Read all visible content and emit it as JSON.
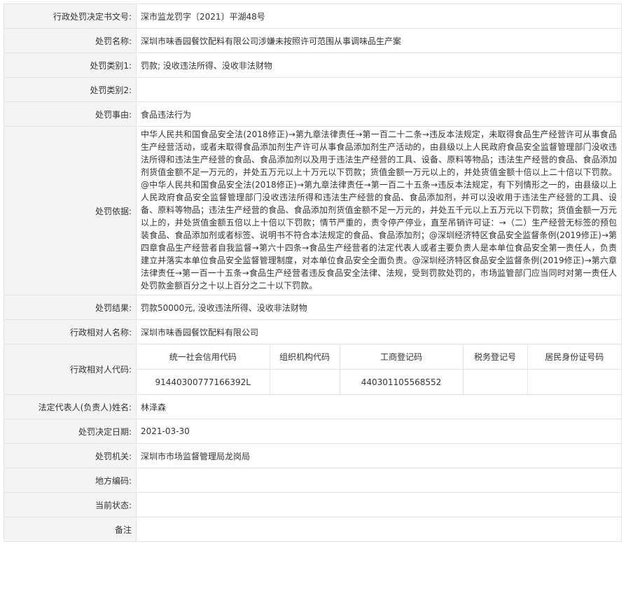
{
  "rows": {
    "doc_no": {
      "label": "行政处罚决定书文号:",
      "value": "深市监龙罚字〔2021〕平湖48号"
    },
    "name": {
      "label": "处罚名称:",
      "value": "深圳市味香园餐饮配料有限公司涉嫌未按照许可范围从事调味品生产案"
    },
    "cat1": {
      "label": "处罚类别1:",
      "value": "罚款; 没收违法所得、没收非法财物"
    },
    "cat2": {
      "label": "处罚类别2:",
      "value": ""
    },
    "reason": {
      "label": "处罚事由:",
      "value": "食品违法行为"
    },
    "basis": {
      "label": "处罚依据:",
      "value": "中华人民共和国食品安全法(2018修正)→第九章法律责任→第一百二十二条→违反本法规定，未取得食品生产经营许可从事食品生产经营活动，或者未取得食品添加剂生产许可从事食品添加剂生产活动的，由县级以上人民政府食品安全监督管理部门没收违法所得和违法生产经营的食品、食品添加剂以及用于违法生产经营的工具、设备、原料等物品；违法生产经营的食品、食品添加剂货值金额不足一万元的，并处五万元以上十万元以下罚款；货值金额一万元以上的，并处货值金额十倍以上二十倍以下罚款。@中华人民共和国食品安全法(2018修正)→第九章法律责任→第一百二十五条→违反本法规定，有下列情形之一的，由县级以上人民政府食品安全监督管理部门没收违法所得和违法生产经营的食品、食品添加剂，并可以没收用于违法生产经营的工具、设备、原料等物品；违法生产经营的食品、食品添加剂货值金额不足一万元的，并处五千元以上五万元以下罚款；货值金额一万元以上的，并处货值金额五倍以上十倍以下罚款；情节严重的，责令停产停业，直至吊销许可证：→（二）生产经营无标签的预包装食品、食品添加剂或者标签、说明书不符合本法规定的食品、食品添加剂；@深圳经济特区食品安全监督条例(2019修正)→第四章食品生产经营者自我监督→第六十四条→食品生产经营者的法定代表人或者主要负责人是本单位食品安全第一责任人，负责建立并落实本单位食品安全监督管理制度，对本单位食品安全全面负责。@深圳经济特区食品安全监督条例(2019修正)→第六章法律责任→第一百一十五条→食品生产经营者违反食品安全法律、法规，受到罚款处罚的，市场监管部门应当同时对第一责任人处罚款金额百分之十以上百分之二十以下罚款。"
    },
    "result": {
      "label": "处罚结果:",
      "value": "罚款50000元, 没收违法所得、没收非法财物"
    },
    "party": {
      "label": "行政相对人名称:",
      "value": "深圳市味香园餐饮配料有限公司"
    },
    "codes": {
      "label": "行政相对人代码:",
      "headers": [
        "统一社会信用代码",
        "组织机构代码",
        "工商登记码",
        "税务登记号",
        "居民身份证号码"
      ],
      "values": [
        "91440300777166392L",
        "",
        "440301105568552",
        "",
        ""
      ]
    },
    "legal_rep": {
      "label": "法定代表人(负责人)姓名:",
      "value": "林泽森"
    },
    "date": {
      "label": "处罚决定日期:",
      "value": "2021-03-30"
    },
    "authority": {
      "label": "处罚机关:",
      "value": "深圳市市场监督管理局龙岗局"
    },
    "region": {
      "label": "地方编码:",
      "value": ""
    },
    "status": {
      "label": "当前状态:",
      "value": ""
    },
    "remark": {
      "label": "备注",
      "value": ""
    }
  }
}
